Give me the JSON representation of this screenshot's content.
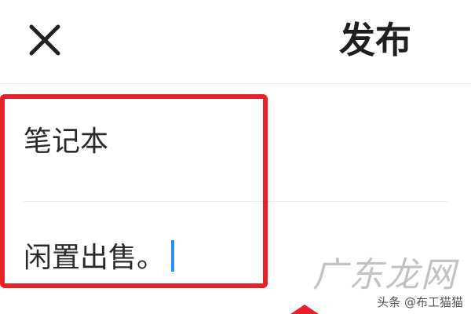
{
  "header": {
    "close_icon": "close-icon",
    "publish_label": "发布"
  },
  "form": {
    "title_value": "笔记本",
    "description_value": "闲置出售。"
  },
  "annotation": {
    "highlight_color": "#e8202a"
  },
  "watermark": {
    "main_text": "广东龙网",
    "credit_text": "头条 @布工猫猫"
  },
  "colors": {
    "caret": "#2f8ef0",
    "text": "#1a1a1a"
  }
}
